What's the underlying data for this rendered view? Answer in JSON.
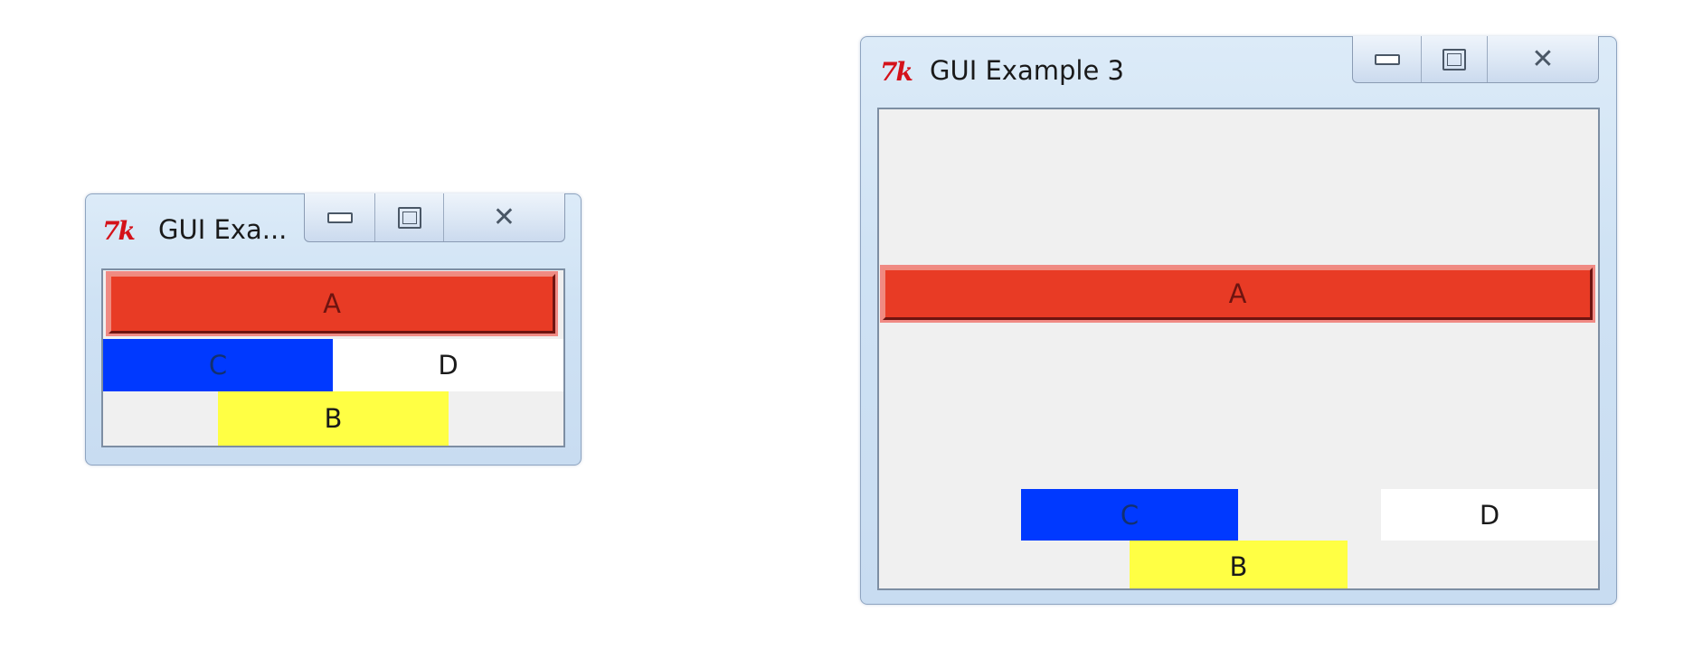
{
  "window_small": {
    "logo": "7k",
    "title": "GUI Exa...",
    "minimize_icon": "minimize-icon",
    "maximize_icon": "maximize-icon",
    "close_icon": "close-icon",
    "widgets": {
      "a": "A",
      "c": "C",
      "d": "D",
      "b": "B"
    }
  },
  "window_large": {
    "logo": "7k",
    "title": "GUI Example 3",
    "minimize_icon": "minimize-icon",
    "maximize_icon": "maximize-icon",
    "close_icon": "close-icon",
    "widgets": {
      "a": "A",
      "c": "C",
      "d": "D",
      "b": "B"
    }
  },
  "colors": {
    "a": "#e83b25",
    "c": "#0039ff",
    "d": "#ffffff",
    "b": "#ffff44",
    "client_bg": "#f0f0f0",
    "frame": "#cfe2f4"
  }
}
